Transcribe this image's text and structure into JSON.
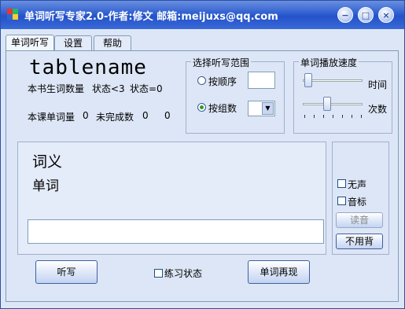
{
  "window": {
    "title": "单词听写专家2.0-作者:修文  邮箱:meijuxs@qq.com"
  },
  "tabs": [
    {
      "label": "单词听写"
    },
    {
      "label": "设置"
    },
    {
      "label": "帮助"
    }
  ],
  "book": {
    "name": "tablename",
    "new_words_label": "本书生词数量",
    "status_a": "状态<3",
    "status_b": "状态=0",
    "lesson_words_label": "本课单词量",
    "lesson_words_value": "0",
    "incomplete_label": "未完成数",
    "incomplete_value_1": "0",
    "incomplete_value_2": "0"
  },
  "range_group": {
    "title": "选择听写范围",
    "option_sequence": "按顺序",
    "option_group": "按组数",
    "selected": "按组数",
    "sequence_value": "",
    "group_value": ""
  },
  "speed_group": {
    "title": "单词播放速度",
    "time_label": "时间",
    "count_label": "次数"
  },
  "display": {
    "meaning": "词义",
    "word": "单词",
    "input_value": ""
  },
  "side": {
    "mute_label": "无声",
    "phonetic_label": "音标",
    "read_button": "读音",
    "skip_button": "不用背"
  },
  "bottom": {
    "dictate_button": "听写",
    "practice_label": "练习状态",
    "replay_button": "单词再现"
  }
}
